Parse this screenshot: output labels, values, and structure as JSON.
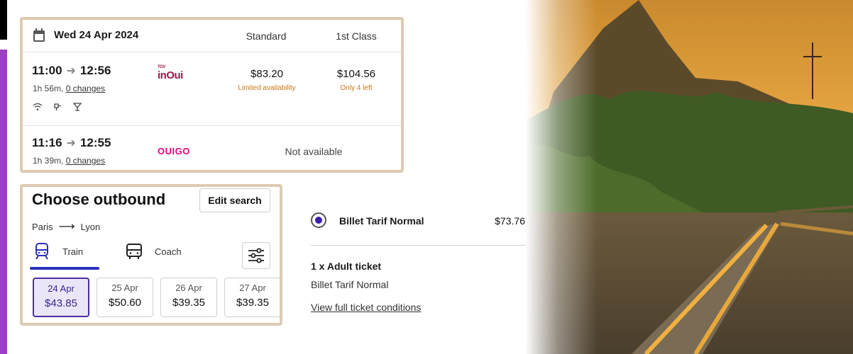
{
  "trip": {
    "date": "Wed 24 Apr 2024",
    "col_standard": "Standard",
    "col_first": "1st Class",
    "rows": [
      {
        "depart": "11:00",
        "arrive": "12:56",
        "duration": "1h 56m, ",
        "changes": "0 changes",
        "operator": "inOui",
        "operator_small": "TGV",
        "standard_price": "$83.20",
        "standard_note": "Limited availability",
        "first_price": "$104.56",
        "first_note": "Only 4 left",
        "amenities": [
          "wifi-icon",
          "power-socket-icon",
          "bar-icon"
        ]
      },
      {
        "depart": "11:16",
        "arrive": "12:55",
        "duration": "1h 39m, ",
        "changes": "0 changes",
        "operator": "OUIGO",
        "status": "Not available"
      }
    ]
  },
  "outbound": {
    "title": "Choose outbound",
    "edit_label": "Edit search",
    "from": "Paris",
    "to": "Lyon",
    "tabs": [
      {
        "label": "Train",
        "icon": "train-icon",
        "selected": true
      },
      {
        "label": "Coach",
        "icon": "coach-icon",
        "selected": false
      }
    ],
    "dates": [
      {
        "date": "24 Apr",
        "price": "$43.85",
        "selected": true
      },
      {
        "date": "25 Apr",
        "price": "$50.60",
        "selected": false
      },
      {
        "date": "26 Apr",
        "price": "$39.35",
        "selected": false
      },
      {
        "date": "27 Apr",
        "price": "$39.35",
        "selected": false
      }
    ]
  },
  "fare": {
    "name": "Billet Tarif Normal",
    "price": "$73.76",
    "ticket_title": "1 x Adult ticket",
    "ticket_subtitle": "Billet Tarif Normal",
    "conditions_link": "View full ticket conditions"
  },
  "colors": {
    "accent": "#2b2fb8",
    "selected_bg": "#ebe6f7",
    "availability": "#c87619",
    "card_border": "#dccbb3",
    "side_stripe": "#9b3fc7"
  }
}
